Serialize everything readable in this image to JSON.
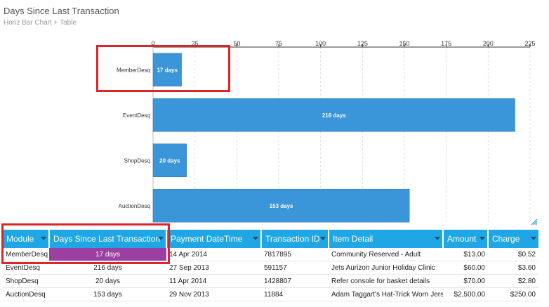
{
  "header": {
    "title": "Days Since Last Transaction",
    "subtitle": "Horiz Bar Chart + Table"
  },
  "chart_data": {
    "type": "bar",
    "orientation": "horizontal",
    "categories": [
      "MemberDesq",
      "EventDesq",
      "ShopDesq",
      "AuctionDesq"
    ],
    "values": [
      17,
      216,
      20,
      153
    ],
    "value_labels": [
      "17 days",
      "216 days",
      "20 days",
      "153 days"
    ],
    "xlim": [
      0,
      225
    ],
    "x_ticks": [
      0,
      25,
      50,
      75,
      100,
      125,
      150,
      175,
      200,
      225
    ],
    "x_tick_labels": [
      "0",
      "25",
      "50",
      "75",
      "100",
      "125",
      "150",
      "175",
      "200",
      "225"
    ],
    "x_axis_position": "top",
    "grid": true,
    "bar_color": "#3a95d9"
  },
  "table": {
    "columns": [
      "Module",
      "Days Since Last Transaction",
      "Payment DateTime",
      "Transaction ID",
      "Item Detail",
      "Amount",
      "Charge"
    ],
    "rows": [
      [
        "MemberDesq",
        "17 days",
        "14 Apr 2014",
        "7817895",
        "Community Reserved - Adult",
        "$13.00",
        "$0.52"
      ],
      [
        "EventDesq",
        "216 days",
        "27 Sep 2013",
        "591157",
        "Jets Aurizon Junior Holiday Clinic",
        "$60.00",
        "$3.60"
      ],
      [
        "ShopDesq",
        "20 days",
        "11 Apr 2014",
        "1428807",
        "Refer console for basket details",
        "$70.00",
        "$2.80"
      ],
      [
        "AuctionDesq",
        "153 days",
        "29 Nov 2013",
        "11884",
        "Adam Taggart's Hat-Trick Worn Jersey",
        "$2,500.00",
        "$250.00"
      ]
    ],
    "highlighted_row": 0,
    "highlight_color": "#9b3fa3",
    "header_color": "#1ea7e4"
  },
  "annotation_color": "#d9252b"
}
